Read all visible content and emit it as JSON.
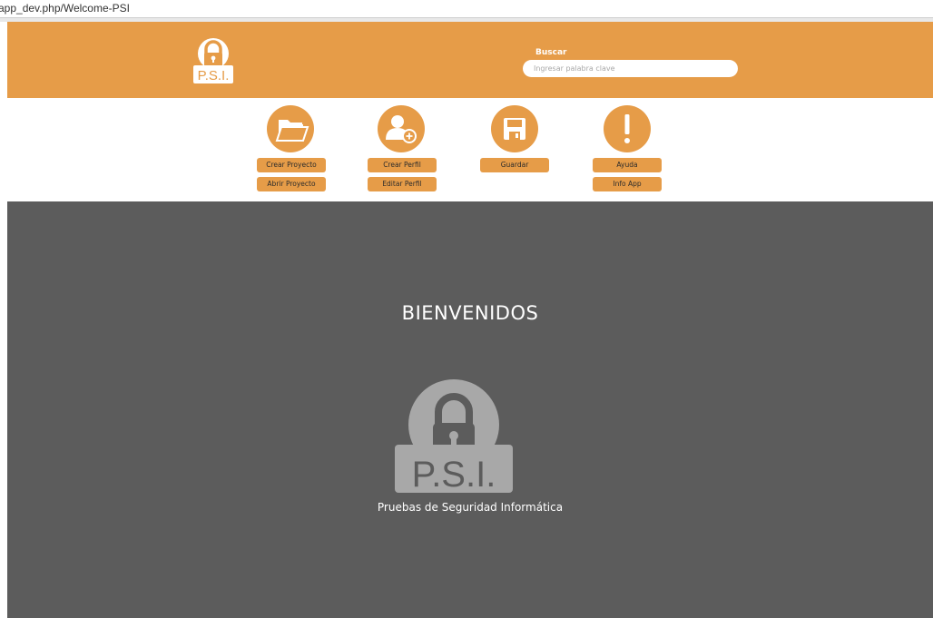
{
  "browser": {
    "url": "app_dev.php/Welcome-PSI"
  },
  "colors": {
    "accent": "#e69c48",
    "main_bg": "#5c5c5c",
    "logo_gray": "#a8a8a8"
  },
  "header": {
    "logo_text": "P.S.I.",
    "search": {
      "label": "Buscar",
      "placeholder": "Ingresar palabra clave",
      "value": ""
    }
  },
  "toolbar": {
    "groups": [
      {
        "icon": "folder-icon",
        "buttons": [
          "Crear Proyecto",
          "Abrir Proyecto"
        ]
      },
      {
        "icon": "add-user-icon",
        "buttons": [
          "Crear Perfil",
          "Editar Perfil"
        ]
      },
      {
        "icon": "save-icon",
        "buttons": [
          "Guardar"
        ]
      },
      {
        "icon": "exclamation-icon",
        "buttons": [
          "Ayuda",
          "Info App"
        ]
      }
    ]
  },
  "main": {
    "welcome_title": "BIENVENIDOS",
    "logo_text": "P.S.I.",
    "tagline": "Pruebas de Seguridad Informática"
  }
}
